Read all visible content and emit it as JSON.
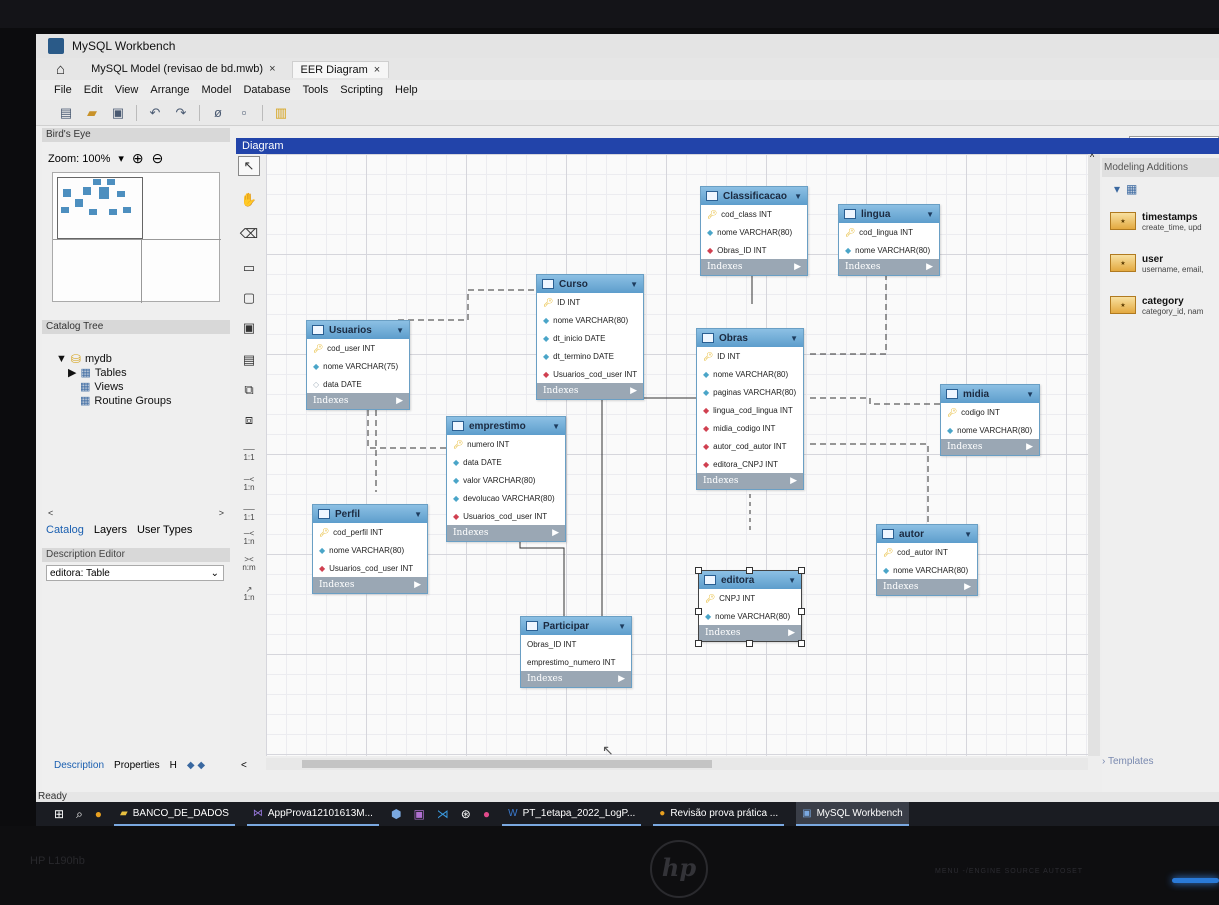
{
  "window": {
    "app_title": "MySQL Workbench"
  },
  "tabs": [
    {
      "label": "MySQL Model (revisao de bd.mwb)",
      "close": "×"
    },
    {
      "label": "EER Diagram",
      "close": "×"
    }
  ],
  "menu": [
    "File",
    "Edit",
    "View",
    "Arrange",
    "Model",
    "Database",
    "Tools",
    "Scripting",
    "Help"
  ],
  "left_panel": {
    "birds_eye_label": "Bird's Eye",
    "zoom_label": "Zoom: 100%",
    "zoom_dropdown": "▾",
    "zoom_in": "⊕",
    "zoom_out": "⊖",
    "catalog_tree_label": "Catalog Tree",
    "tree": {
      "db": "mydb",
      "tables": "Tables",
      "views": "Views",
      "routine_groups": "Routine Groups"
    },
    "tabs": [
      "Catalog",
      "Layers",
      "User Types"
    ],
    "description_editor_label": "Description Editor",
    "description_select": "editora: Table",
    "bottom_tabs": [
      "Description",
      "Properties",
      "H"
    ]
  },
  "diagram": {
    "header": "Diagram",
    "indexes_label": "Indexes",
    "tables": {
      "usuarios": {
        "name": "Usuarios",
        "columns": [
          {
            "kind": "key",
            "text": "cod_user INT"
          },
          {
            "kind": "attr",
            "text": "nome VARCHAR(75)"
          },
          {
            "kind": "opt",
            "text": "data DATE"
          }
        ]
      },
      "curso": {
        "name": "Curso",
        "columns": [
          {
            "kind": "key",
            "text": "ID INT"
          },
          {
            "kind": "attr",
            "text": "nome VARCHAR(80)"
          },
          {
            "kind": "attr",
            "text": "dt_inicio DATE"
          },
          {
            "kind": "attr",
            "text": "dt_termino DATE"
          },
          {
            "kind": "fk",
            "text": "Usuarios_cod_user INT"
          }
        ]
      },
      "classificacao": {
        "name": "Classificacao",
        "columns": [
          {
            "kind": "key",
            "text": "cod_class INT"
          },
          {
            "kind": "attr",
            "text": "nome VARCHAR(80)"
          },
          {
            "kind": "fk",
            "text": "Obras_ID INT"
          }
        ]
      },
      "lingua": {
        "name": "lingua",
        "columns": [
          {
            "kind": "key",
            "text": "cod_lingua INT"
          },
          {
            "kind": "attr",
            "text": "nome VARCHAR(80)"
          }
        ]
      },
      "obras": {
        "name": "Obras",
        "columns": [
          {
            "kind": "key",
            "text": "ID INT"
          },
          {
            "kind": "attr",
            "text": "nome VARCHAR(80)"
          },
          {
            "kind": "attr",
            "text": "paginas VARCHAR(80)"
          },
          {
            "kind": "fk",
            "text": "lingua_cod_lingua INT"
          },
          {
            "kind": "fk",
            "text": "midia_codigo INT"
          },
          {
            "kind": "fk",
            "text": "autor_cod_autor INT"
          },
          {
            "kind": "fk",
            "text": "editora_CNPJ INT"
          }
        ]
      },
      "midia": {
        "name": "midia",
        "columns": [
          {
            "kind": "key",
            "text": "codigo INT"
          },
          {
            "kind": "attr",
            "text": "nome VARCHAR(80)"
          }
        ]
      },
      "emprestimo": {
        "name": "emprestimo",
        "columns": [
          {
            "kind": "key",
            "text": "numero INT"
          },
          {
            "kind": "attr",
            "text": "data DATE"
          },
          {
            "kind": "attr",
            "text": "valor VARCHAR(80)"
          },
          {
            "kind": "attr",
            "text": "devolucao VARCHAR(80)"
          },
          {
            "kind": "fk",
            "text": "Usuarios_cod_user INT"
          }
        ]
      },
      "perfil": {
        "name": "Perfil",
        "columns": [
          {
            "kind": "key",
            "text": "cod_perfil INT"
          },
          {
            "kind": "attr",
            "text": "nome VARCHAR(80)"
          },
          {
            "kind": "fk",
            "text": "Usuarios_cod_user INT"
          }
        ]
      },
      "participar": {
        "name": "Participar",
        "columns": [
          {
            "kind": "plain",
            "text": "Obras_ID INT"
          },
          {
            "kind": "plain",
            "text": "emprestimo_numero INT"
          }
        ]
      },
      "editora": {
        "name": "editora",
        "columns": [
          {
            "kind": "key",
            "text": "CNPJ INT"
          },
          {
            "kind": "attr",
            "text": "nome VARCHAR(80)"
          }
        ]
      },
      "autor": {
        "name": "autor",
        "columns": [
          {
            "kind": "key",
            "text": "cod_autor INT"
          },
          {
            "kind": "attr",
            "text": "nome VARCHAR(80)"
          }
        ]
      }
    }
  },
  "palette": {
    "rel_labels": [
      "1:1",
      "1:n",
      "1:1",
      "1:n",
      "n:m",
      "1:n"
    ]
  },
  "right_panel": {
    "header": "Modeling Additions",
    "additions": [
      {
        "title": "timestamps",
        "sub": "create_time, upd"
      },
      {
        "title": "user",
        "sub": "username, email,"
      },
      {
        "title": "category",
        "sub": "category_id, nam"
      }
    ],
    "templates_label": "Templates"
  },
  "status": "Ready",
  "taskbar": {
    "items": [
      "BANCO_DE_DADOS",
      "AppProva12101613M...",
      "PT_1etapa_2022_LogP...",
      "Revisão prova prática ...",
      "MySQL Workbench"
    ]
  },
  "monitor": {
    "model": "HP L190hb",
    "buttons": "MENU  -/ENGINE  SOURCE  AUTOSET",
    "logo": "hp"
  },
  "colors": {
    "diagram_header": "#2244aa",
    "table_header": "#5d9dcc",
    "indexes_bar": "#9aa7b4",
    "primary_key": "#e3b21c",
    "foreign_key": "#d04050"
  }
}
